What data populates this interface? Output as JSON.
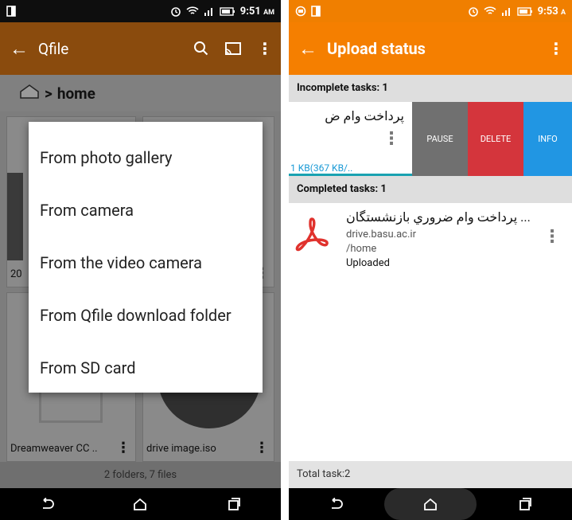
{
  "left": {
    "status": {
      "time": "9:51",
      "ampm": "AM"
    },
    "appbar": {
      "title": "Qfile"
    },
    "breadcrumb": {
      "separator": ">",
      "path": "home"
    },
    "files": [
      {
        "name": "Dreamweaver CC ..",
        "kind": "file"
      },
      {
        "name": "drive image.iso",
        "kind": "file"
      }
    ],
    "partial_label": "20",
    "footer": {
      "count": "2 folders, 7 files"
    },
    "dialog": {
      "options": [
        "From photo gallery",
        "From camera",
        "From the video camera",
        "From Qfile download folder",
        "From SD card"
      ]
    }
  },
  "right": {
    "status": {
      "time": "9:53",
      "ampm": "A"
    },
    "appbar": {
      "title": "Upload status"
    },
    "incomplete": {
      "header": "Incomplete tasks: 1",
      "task": {
        "title": "پرداخت وام ض",
        "size": "1 KB(367 KB/..",
        "progress": 1.0
      },
      "actions": {
        "pause": "PAUSE",
        "delete": "DELETE",
        "info": "INFO"
      }
    },
    "completed": {
      "header": "Completed tasks: 1",
      "task": {
        "title": "پرداخت وام ضروري بازنشستگان ...",
        "host": "drive.basu.ac.ir",
        "path": "/home",
        "status": "Uploaded"
      }
    },
    "footer": {
      "total": "Total task:2"
    }
  },
  "colors": {
    "accent_orange": "#f57f00",
    "delete_red": "#d4353c",
    "info_blue": "#2196e3",
    "pdf_red": "#e0322d"
  }
}
